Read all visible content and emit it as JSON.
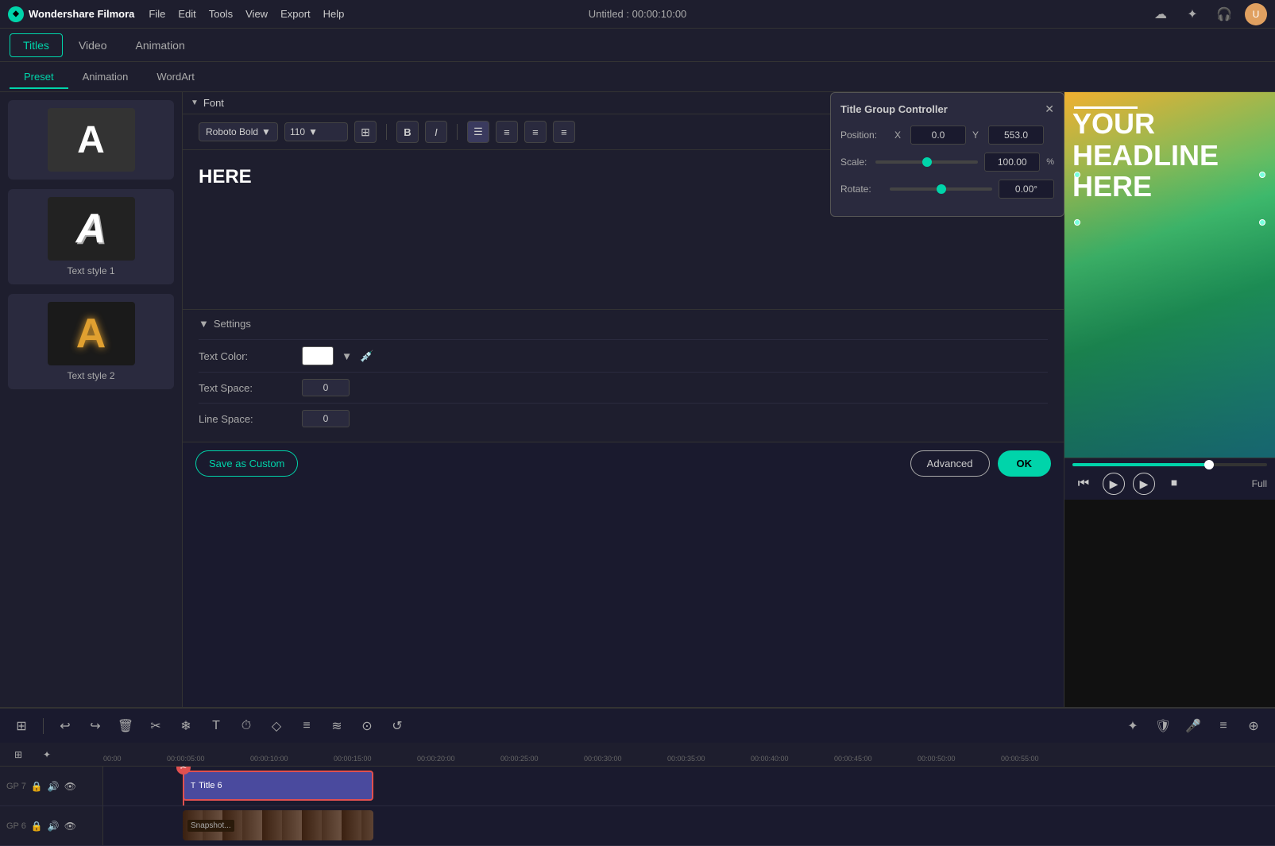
{
  "app": {
    "name": "Wondershare Filmora",
    "logo_symbol": "◆",
    "title": "Untitled : 00:00:10:00"
  },
  "menu": {
    "items": [
      "File",
      "Edit",
      "Tools",
      "View",
      "Export",
      "Help"
    ]
  },
  "tabs": {
    "items": [
      "Titles",
      "Video",
      "Animation"
    ],
    "active": "Titles"
  },
  "sub_tabs": {
    "items": [
      "Preset",
      "Animation",
      "WordArt"
    ],
    "active": "Preset"
  },
  "text_styles": [
    {
      "label": "",
      "letter": "A",
      "style": "default"
    },
    {
      "label": "Text style 1",
      "letter": "A",
      "style": "style2"
    },
    {
      "label": "Text style 2",
      "letter": "A",
      "style": "style3"
    }
  ],
  "font_section": {
    "label": "Font",
    "font_name": "Roboto Bold",
    "font_size": "110",
    "text_content": "HERE"
  },
  "settings_section": {
    "label": "Settings",
    "text_color_label": "Text Color:",
    "text_space_label": "Text Space:",
    "text_space_value": "0",
    "line_space_label": "Line Space:",
    "line_space_value": "0"
  },
  "buttons": {
    "save_custom": "Save as Custom",
    "advanced": "Advanced",
    "ok": "OK"
  },
  "title_controller": {
    "title": "Title Group Controller",
    "close": "✕",
    "position_label": "Position:",
    "x_label": "X",
    "x_value": "0.0",
    "y_label": "Y",
    "y_value": "553.0",
    "scale_label": "Scale:",
    "scale_value": "100.00",
    "scale_unit": "%",
    "rotate_label": "Rotate:",
    "rotate_value": "0.00°"
  },
  "preview": {
    "text_line1": "YOUR",
    "text_line2": "HEADLINE",
    "text_line3": "HERE"
  },
  "playback": {
    "progress_pct": 70,
    "full_label": "Full"
  },
  "timeline": {
    "time_markers": [
      "00:00",
      "00:00:05:00",
      "00:00:10:00",
      "00:00:15:00",
      "00:00:20:00",
      "00:00:25:00",
      "00:00:30:00",
      "00:00:35:00",
      "00:00:40:00",
      "00:00:45:00",
      "00:00:50:00",
      "00:00:55:00"
    ],
    "tracks": [
      {
        "id": "7",
        "type": "title",
        "label": "Title 6"
      },
      {
        "id": "6",
        "type": "video",
        "label": "Snapshot..."
      }
    ]
  },
  "toolbar_tools": [
    "⊞",
    "↩",
    "↪",
    "🗑",
    "✂",
    "✦",
    "T+",
    "⏱",
    "◇",
    "≡",
    "≋",
    "⊙",
    "↺"
  ],
  "toolbar_right": [
    "✦",
    "🛡",
    "🎤",
    "≡",
    "⊕"
  ]
}
